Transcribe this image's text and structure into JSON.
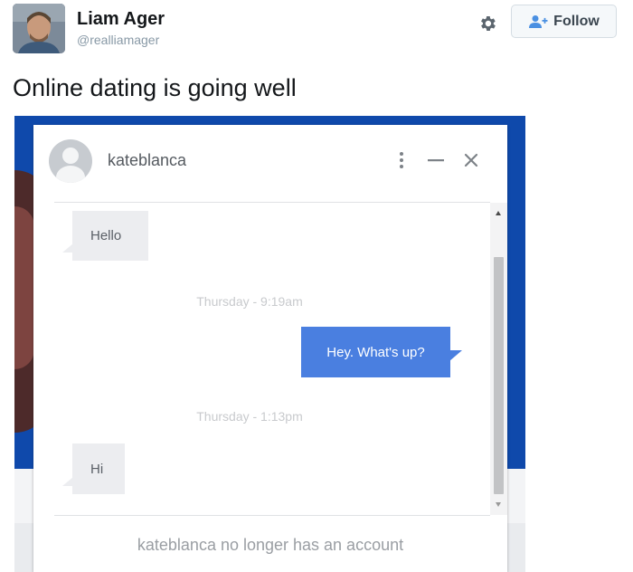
{
  "tweet": {
    "author_name": "Liam Ager",
    "author_handle": "@realliamager",
    "text": "Online dating is going well",
    "follow_label": "Follow",
    "icons": {
      "settings": "gear-icon",
      "follow": "add-user-icon"
    },
    "colors": {
      "follow_icon": "#4a90e2"
    }
  },
  "chat": {
    "username": "kateblanca",
    "controls": {
      "more_label": "⋮",
      "minimize_label": "—",
      "close_label": "✕"
    },
    "messages": [
      {
        "direction": "incoming",
        "text": "Hello"
      },
      {
        "direction": "timestamp",
        "text": "Thursday - 9:19am"
      },
      {
        "direction": "outgoing",
        "text": "Hey. What's up?"
      },
      {
        "direction": "timestamp",
        "text": "Thursday - 1:13pm"
      },
      {
        "direction": "incoming",
        "text": "Hi"
      }
    ],
    "notice": "kateblanca no longer has an account",
    "colors": {
      "outgoing_bubble": "#4a7fe0",
      "incoming_bubble": "#ecedf0",
      "background_frame": "#0f49ab"
    }
  }
}
